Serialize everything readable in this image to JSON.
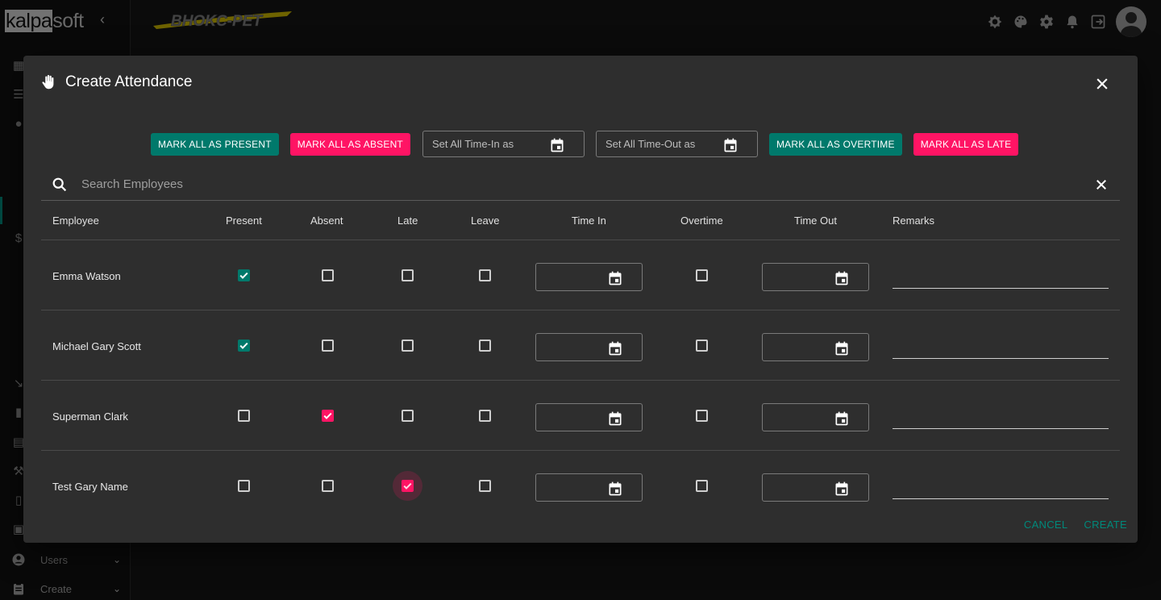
{
  "app": {
    "brand_part1": "kalpa",
    "brand_part2": "soft",
    "logo_text": "BHOKC-PET",
    "sidebar": [
      {
        "label": "Users",
        "icon": "account-circle-icon"
      },
      {
        "label": "Create",
        "icon": "clipboard-icon"
      }
    ],
    "top_icons": [
      "theme-brightness-icon",
      "palette-icon",
      "settings-icon",
      "notifications-icon",
      "logout-icon",
      "avatar-icon"
    ]
  },
  "dialog": {
    "title": "Create Attendance",
    "icon": "hand-icon",
    "actions": {
      "mark_present": "MARK ALL AS PRESENT",
      "mark_absent": "MARK ALL AS ABSENT",
      "time_in_placeholder": "Set All Time-In as",
      "time_out_placeholder": "Set All Time-Out as",
      "mark_overtime": "MARK ALL AS OVERTIME",
      "mark_late": "MARK ALL AS LATE"
    },
    "search": {
      "placeholder": "Search Employees"
    },
    "columns": [
      "Employee",
      "Present",
      "Absent",
      "Late",
      "Leave",
      "Time In",
      "Overtime",
      "Time Out",
      "Remarks"
    ],
    "rows": [
      {
        "employee": "Emma Watson",
        "present": true,
        "absent": false,
        "late": false,
        "leave": false,
        "overtime": false,
        "time_in": "",
        "time_out": "",
        "remarks": ""
      },
      {
        "employee": "Michael Gary Scott",
        "present": true,
        "absent": false,
        "late": false,
        "leave": false,
        "overtime": false,
        "time_in": "",
        "time_out": "",
        "remarks": ""
      },
      {
        "employee": "Superman Clark",
        "present": false,
        "absent": true,
        "late": false,
        "leave": false,
        "overtime": false,
        "time_in": "",
        "time_out": "",
        "remarks": ""
      },
      {
        "employee": "Test Gary Name",
        "present": false,
        "absent": false,
        "late": true,
        "leave": false,
        "overtime": false,
        "time_in": "",
        "time_out": "",
        "remarks": ""
      }
    ],
    "footer": {
      "cancel": "CANCEL",
      "create": "CREATE"
    }
  },
  "colors": {
    "teal": "#00796b",
    "pink": "#ff1464",
    "dialog_bg": "#2e2e2e",
    "page_bg": "#141414"
  }
}
